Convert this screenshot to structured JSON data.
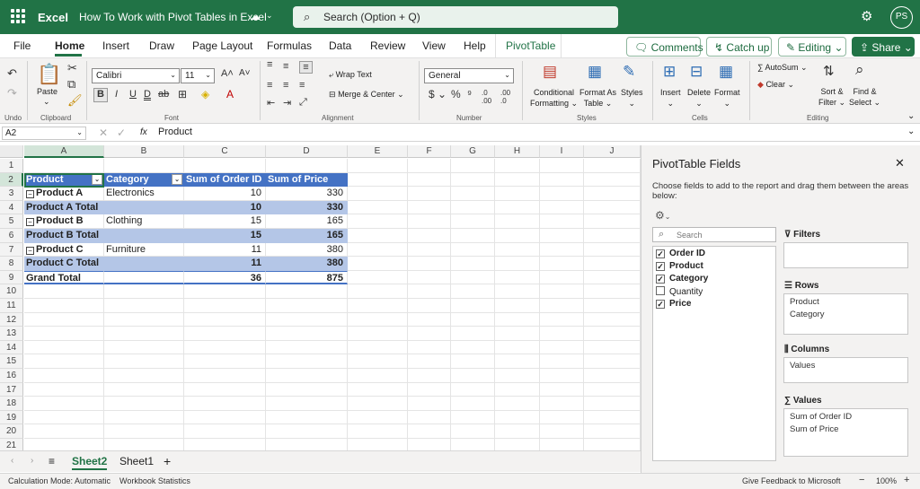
{
  "titlebar": {
    "app_name": "Excel",
    "doc_title": "How To Work with Pivot Tables in Excel",
    "search_placeholder": "Search (Option + Q)",
    "avatar_initials": "PS"
  },
  "tabs": [
    "File",
    "Home",
    "Insert",
    "Draw",
    "Page Layout",
    "Formulas",
    "Data",
    "Review",
    "View",
    "Help",
    "PivotTable"
  ],
  "active_tab": "Home",
  "top_buttons": {
    "comments": "Comments",
    "catch_up": "Catch up",
    "editing": "Editing",
    "share": "Share"
  },
  "ribbon": {
    "groups": {
      "undo": "Undo",
      "clipboard": "Clipboard",
      "font": "Font",
      "alignment": "Alignment",
      "number": "Number",
      "styles": "Styles",
      "cells": "Cells",
      "editing": "Editing"
    },
    "paste": "Paste",
    "font_name": "Calibri",
    "font_size": "11",
    "wrap_text": "Wrap Text",
    "merge_center": "Merge & Center",
    "number_format": "General",
    "conditional_formatting": [
      "Conditional",
      "Formatting"
    ],
    "format_as_table": [
      "Format As",
      "Table"
    ],
    "styles": "Styles",
    "insert": "Insert",
    "delete": "Delete",
    "format": "Format",
    "autosum": "AutoSum",
    "clear": "Clear",
    "sort_filter": [
      "Sort &",
      "Filter"
    ],
    "find_select": [
      "Find &",
      "Select"
    ]
  },
  "formula_bar": {
    "name_box": "A2",
    "fx": "fx",
    "content": "Product"
  },
  "columns": [
    "A",
    "B",
    "C",
    "D",
    "E",
    "F",
    "G",
    "H",
    "I",
    "J"
  ],
  "rows": [
    "1",
    "2",
    "3",
    "4",
    "5",
    "6",
    "7",
    "8",
    "9",
    "10",
    "11",
    "12",
    "13",
    "14",
    "15",
    "16",
    "17",
    "18",
    "19",
    "20",
    "21"
  ],
  "pivot": {
    "headers": [
      "Product",
      "Category",
      "Sum of Order ID",
      "Sum of Price"
    ],
    "rows": [
      {
        "a": "Product A",
        "b": "Electronics",
        "c": "10",
        "d": "330",
        "type": "item"
      },
      {
        "a": "Product A Total",
        "b": "",
        "c": "10",
        "d": "330",
        "type": "total"
      },
      {
        "a": "Product B",
        "b": "Clothing",
        "c": "15",
        "d": "165",
        "type": "item"
      },
      {
        "a": "Product B Total",
        "b": "",
        "c": "15",
        "d": "165",
        "type": "total"
      },
      {
        "a": "Product C",
        "b": "Furniture",
        "c": "11",
        "d": "380",
        "type": "item"
      },
      {
        "a": "Product C Total",
        "b": "",
        "c": "11",
        "d": "380",
        "type": "total"
      },
      {
        "a": "Grand Total",
        "b": "",
        "c": "36",
        "d": "875",
        "type": "grand"
      }
    ]
  },
  "sheets": {
    "tabs": [
      "Sheet2",
      "Sheet1"
    ],
    "active": "Sheet2"
  },
  "status": {
    "calc_mode": "Calculation Mode: Automatic",
    "workbook_stats": "Workbook Statistics",
    "feedback": "Give Feedback to Microsoft",
    "zoom": "100%"
  },
  "pivot_panel": {
    "title": "PivotTable Fields",
    "subtitle": "Choose fields to add to the report and drag them between the areas below:",
    "search_placeholder": "Search",
    "fields": [
      {
        "name": "Order ID",
        "checked": true
      },
      {
        "name": "Product",
        "checked": true
      },
      {
        "name": "Category",
        "checked": true
      },
      {
        "name": "Quantity",
        "checked": false
      },
      {
        "name": "Price",
        "checked": true
      }
    ],
    "areas": {
      "filters": {
        "title": "Filters",
        "items": []
      },
      "rows": {
        "title": "Rows",
        "items": [
          "Product",
          "Category"
        ]
      },
      "columns": {
        "title": "Columns",
        "items": [
          "Values"
        ]
      },
      "values": {
        "title": "Values",
        "items": [
          "Sum of Order ID",
          "Sum of Price"
        ]
      }
    }
  },
  "colors": {
    "brand": "#217346",
    "pivot_header": "#4472c4",
    "pivot_total": "#b4c6e7"
  }
}
